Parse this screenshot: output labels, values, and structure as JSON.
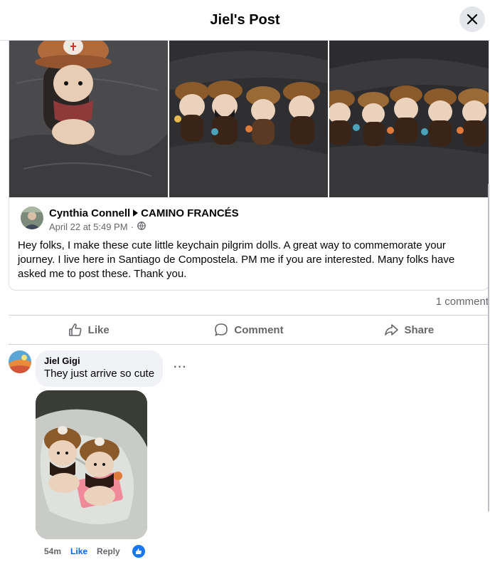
{
  "header": {
    "title": "Jiel's Post"
  },
  "shared_post": {
    "author": "Cynthia Connell",
    "group": "CAMINO FRANCÉS",
    "timestamp": "April 22 at 5:49 PM",
    "separator": "·",
    "text": "Hey folks, I make these cute little keychain pilgrim dolls.  A great way to commemorate your journey.  I live here in Santiago de Compostela.  PM me if you are interested.  Many folks have asked me to post these.  Thank you."
  },
  "stats": {
    "comment_count": "1 comment"
  },
  "actions": {
    "like": "Like",
    "comment": "Comment",
    "share": "Share"
  },
  "comment": {
    "author": "Jiel Gigi",
    "text": "They just arrive so cute",
    "more": "···",
    "time": "54m",
    "like": "Like",
    "reply": "Reply"
  },
  "colors": {
    "accent": "#0866ff",
    "like_badge": "#1877f2",
    "muted": "#65676b"
  },
  "icons": [
    "close-icon",
    "play-triangle-icon",
    "globe-icon",
    "thumbs-up-icon",
    "comment-bubble-icon",
    "share-arrow-icon",
    "like-reaction-icon"
  ]
}
